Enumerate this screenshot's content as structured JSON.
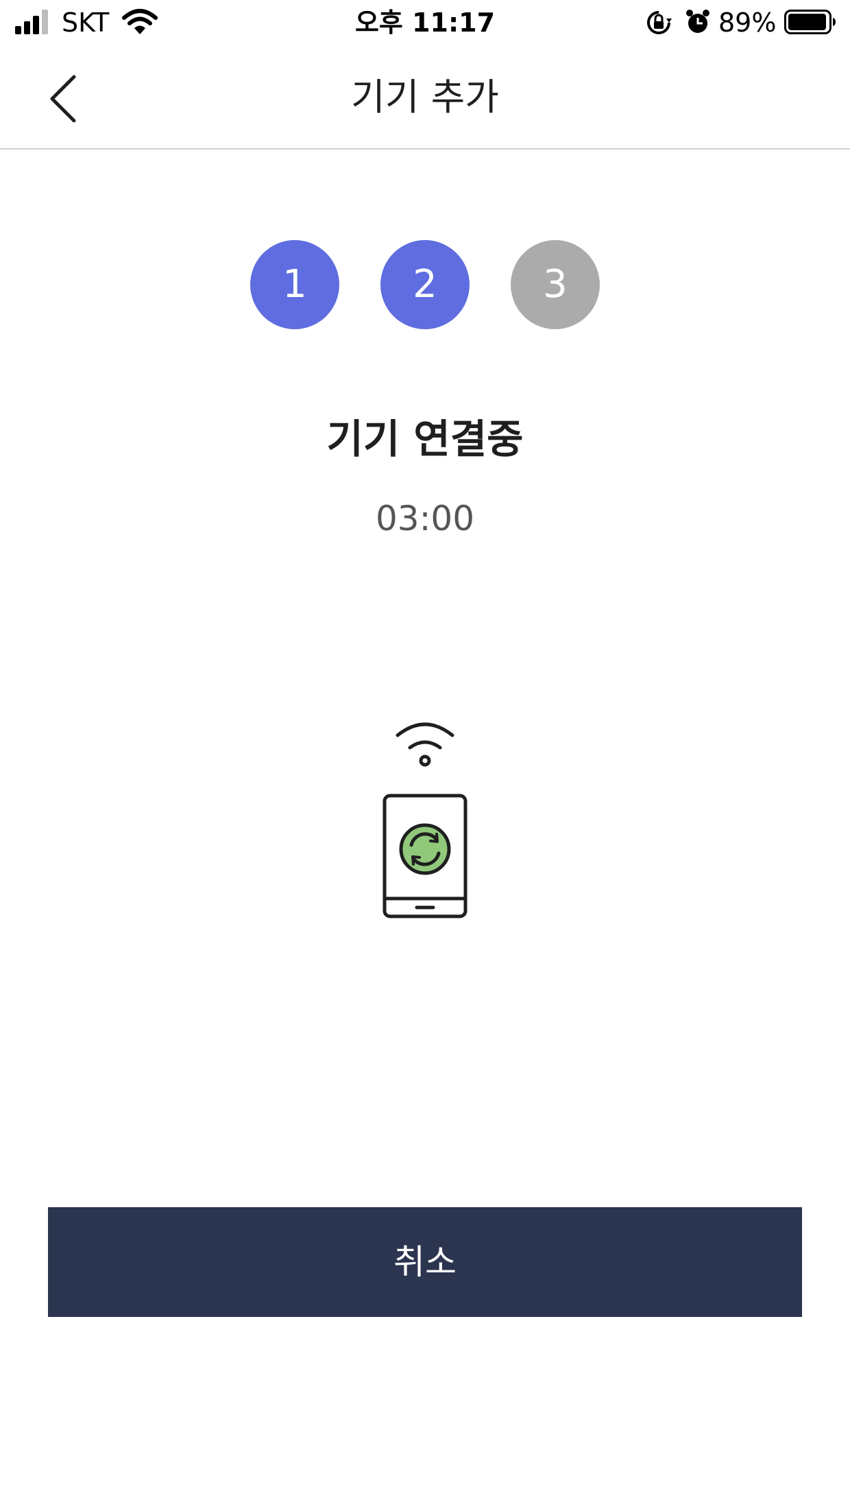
{
  "status_bar": {
    "carrier": "SKT",
    "time": "오후 11:17",
    "battery_percent": "89%",
    "icons": [
      "signal-icon",
      "wifi-icon",
      "rotation-lock-icon",
      "alarm-icon",
      "battery-icon"
    ]
  },
  "header": {
    "title": "기기 추가",
    "back_icon": "chevron-left-icon"
  },
  "steps": [
    {
      "label": "1",
      "state": "completed"
    },
    {
      "label": "2",
      "state": "active"
    },
    {
      "label": "3",
      "state": "inactive"
    }
  ],
  "colors": {
    "step_active": "#5f6de0",
    "step_inactive": "#ababab",
    "cancel_button": "#2c354f",
    "sync_badge": "#90c97a"
  },
  "main": {
    "status_title": "기기 연결중",
    "timer": "03:00",
    "illustration_icon": "phone-wifi-sync-icon"
  },
  "footer": {
    "cancel_label": "취소"
  }
}
